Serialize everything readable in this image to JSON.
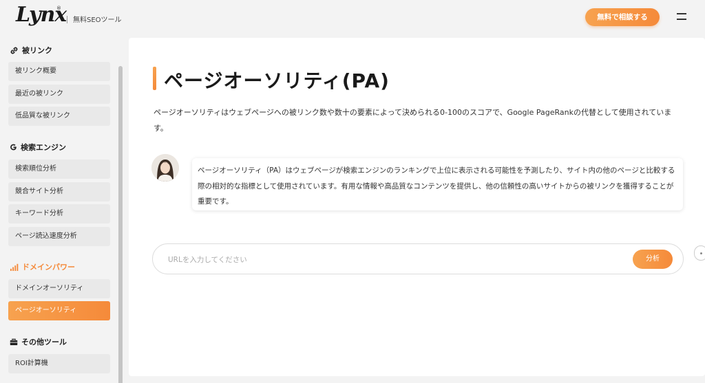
{
  "header": {
    "logo": "Lynx",
    "logo_sup": "®",
    "tagline": "無料SEOツール",
    "cta_label": "無料で相談する"
  },
  "sidebar": {
    "sections": [
      {
        "title": "被リンク",
        "icon": "link-icon",
        "items": [
          "被リンク概要",
          "最近の被リンク",
          "低品質な被リンク"
        ]
      },
      {
        "title": "検索エンジン",
        "icon": "google-g-icon",
        "items": [
          "検索順位分析",
          "競合サイト分析",
          "キーワード分析",
          "ページ読込速度分析"
        ]
      },
      {
        "title": "ドメインパワー",
        "icon": "signal-bars-icon",
        "items": [
          "ドメインオーソリティ",
          "ページオーソリティ"
        ]
      },
      {
        "title": "その他ツール",
        "icon": "toolbox-icon",
        "items": [
          "ROI計算機"
        ]
      }
    ],
    "active_item": "ページオーソリティ"
  },
  "main": {
    "title": "ページオーソリティ(PA)",
    "description": "ページオーソリティはウェブページへの被リンク数や数十の要素によって決められる0-100のスコアで、Google PageRankの代替として使用されています。",
    "bubble_text": "ページオーソリティ（PA）はウェブページが検索エンジンのランキングで上位に表示される可能性を予測したり、サイト内の他のページと比較する際の相対的な指標として使用されています。有用な情報や高品質なコンテンツを提供し、他の信頼性の高いサイトからの被リンクを獲得することが重要です。",
    "url_placeholder": "URLを入力してください",
    "url_value": "",
    "analyze_label": "分析"
  },
  "colors": {
    "accent": "#f58a3a",
    "accent_light": "#f7a24f",
    "sidebar_item_bg": "#e9e9e9",
    "page_bg": "#f3f3f3"
  }
}
